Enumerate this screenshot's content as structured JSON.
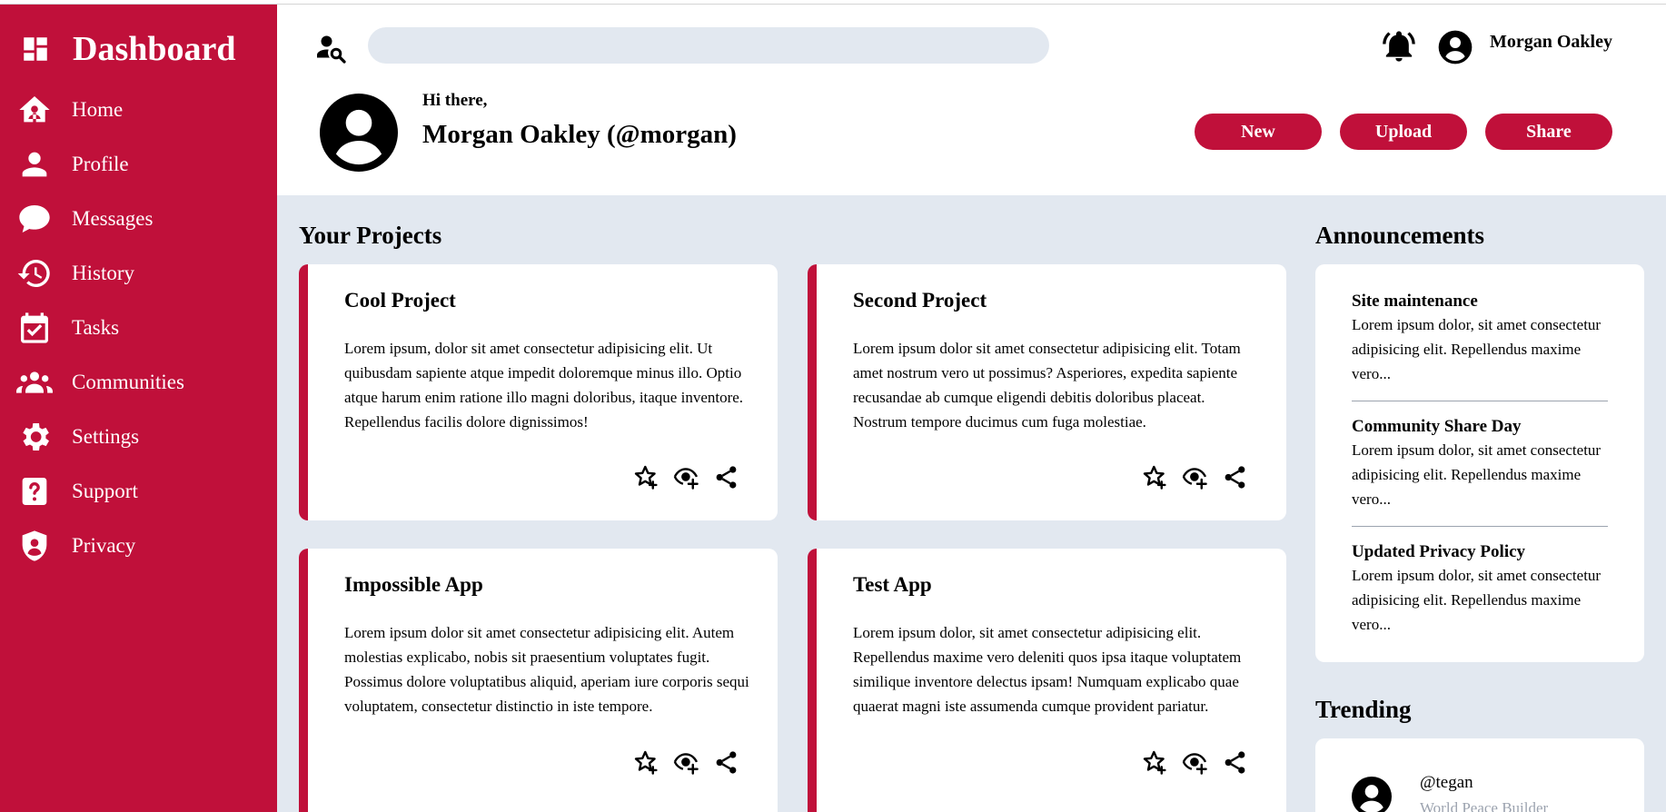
{
  "brand": {
    "title": "Dashboard"
  },
  "sidebar": {
    "items": [
      {
        "label": "Home",
        "icon": "home-icon"
      },
      {
        "label": "Profile",
        "icon": "profile-icon"
      },
      {
        "label": "Messages",
        "icon": "chat-icon"
      },
      {
        "label": "History",
        "icon": "history-icon"
      },
      {
        "label": "Tasks",
        "icon": "calendar-check-icon"
      },
      {
        "label": "Communities",
        "icon": "group-icon"
      },
      {
        "label": "Settings",
        "icon": "gear-icon"
      },
      {
        "label": "Support",
        "icon": "help-icon"
      },
      {
        "label": "Privacy",
        "icon": "shield-user-icon"
      }
    ]
  },
  "header": {
    "search_placeholder": "",
    "username": "Morgan Oakley",
    "greeting": "Hi there,",
    "full_name": "Morgan Oakley (@morgan)",
    "buttons": {
      "new": "New",
      "upload": "Upload",
      "share": "Share"
    }
  },
  "projects": {
    "title": "Your Projects",
    "items": [
      {
        "title": "Cool Project",
        "body": "Lorem ipsum, dolor sit amet consectetur adipisicing elit. Ut quibusdam sapiente atque impedit doloremque minus illo. Optio atque harum enim ratione illo magni doloribus, itaque inventore. Repellendus facilis dolore dignissimos!"
      },
      {
        "title": "Second Project",
        "body": "Lorem ipsum dolor sit amet consectetur adipisicing elit. Totam amet nostrum vero ut possimus? Asperiores, expedita sapiente recusandae ab cumque eligendi debitis doloribus placeat. Nostrum tempore ducimus cum fuga molestiae."
      },
      {
        "title": "Impossible App",
        "body": "Lorem ipsum dolor sit amet consectetur adipisicing elit. Autem molestias explicabo, nobis sit praesentium voluptates fugit. Possimus dolore voluptatibus aliquid, aperiam iure corporis sequi voluptatem, consectetur distinctio in iste tempore."
      },
      {
        "title": "Test App",
        "body": "Lorem ipsum dolor, sit amet consectetur adipisicing elit. Repellendus maxime vero deleniti quos ipsa itaque voluptatem similique inventore delectus ipsam! Numquam explicabo quae quaerat magni iste assumenda cumque provident pariatur."
      }
    ]
  },
  "announcements": {
    "title": "Announcements",
    "items": [
      {
        "title": "Site maintenance",
        "body": "Lorem ipsum dolor, sit amet consectetur adipisicing elit. Repellendus maxime vero..."
      },
      {
        "title": "Community Share Day",
        "body": "Lorem ipsum dolor, sit amet consectetur adipisicing elit. Repellendus maxime vero..."
      },
      {
        "title": "Updated Privacy Policy",
        "body": "Lorem ipsum dolor, sit amet consectetur adipisicing elit. Repellendus maxime vero..."
      }
    ]
  },
  "trending": {
    "title": "Trending",
    "items": [
      {
        "handle": "@tegan",
        "role": "World Peace Builder"
      }
    ]
  },
  "colors": {
    "accent": "#c0103a",
    "background": "#e2e8f0",
    "panel": "#ffffff"
  }
}
